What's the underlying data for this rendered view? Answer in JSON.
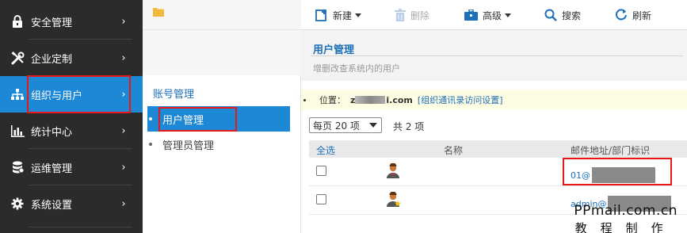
{
  "sidebar": {
    "items": [
      {
        "label": "安全管理",
        "icon": "lock-icon",
        "active": false
      },
      {
        "label": "企业定制",
        "icon": "tools-icon",
        "active": false
      },
      {
        "label": "组织与用户",
        "icon": "org-chart-icon",
        "active": true
      },
      {
        "label": "统计中心",
        "icon": "bar-chart-icon",
        "active": false
      },
      {
        "label": "运维管理",
        "icon": "database-icon",
        "active": false
      },
      {
        "label": "系统设置",
        "icon": "gear-icon",
        "active": false
      }
    ],
    "chevron": "›"
  },
  "subpanel": {
    "heading": "账号管理",
    "items": [
      {
        "label": "用户管理",
        "active": true
      },
      {
        "label": "管理员管理",
        "active": false
      }
    ]
  },
  "toolbar": {
    "new_label": "新建",
    "delete_label": "删除",
    "advanced_label": "高级",
    "search_label": "搜索",
    "refresh_label": "刷新"
  },
  "page": {
    "title": "用户管理",
    "subtitle": "增删改查系统内的用户"
  },
  "location": {
    "label": "位置：",
    "domain_prefix": "z",
    "domain_suffix": "i.com",
    "link": "[组织通讯录访问设置]"
  },
  "pagination": {
    "per_page": "每页 20 项",
    "total": "共 2 项"
  },
  "table": {
    "headers": {
      "select_all": "全选",
      "name": "名称",
      "mail": "邮件地址/部门标识"
    },
    "rows": [
      {
        "mail_prefix": "01@",
        "icon": "user-icon"
      },
      {
        "mail_prefix": "admin@",
        "icon": "admin-user-icon"
      }
    ]
  },
  "watermark": {
    "line1": "PPmail.com.cn",
    "line2": "教程制作"
  },
  "colors": {
    "sidebar_bg": "#2b2b2b",
    "accent": "#1d88d6",
    "link": "#1d6fb8",
    "highlight_box": "#e81818",
    "location_bg": "#fdfde4"
  }
}
